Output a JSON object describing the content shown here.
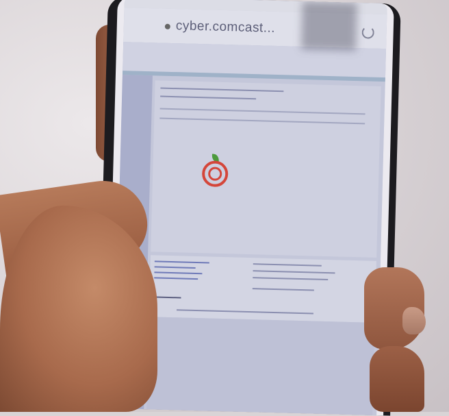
{
  "browser": {
    "url": "cyber.comcast...",
    "status_time": "",
    "status_battery": ""
  },
  "site": {
    "brand_prefix": "",
    "brand_suffix": "",
    "logo_name_red": "",
    "logo_name_green": ""
  },
  "colors": {
    "brand_red": "#d4463a",
    "brand_green": "#4c9a3c",
    "screen_bg": "#c6c8d8"
  }
}
